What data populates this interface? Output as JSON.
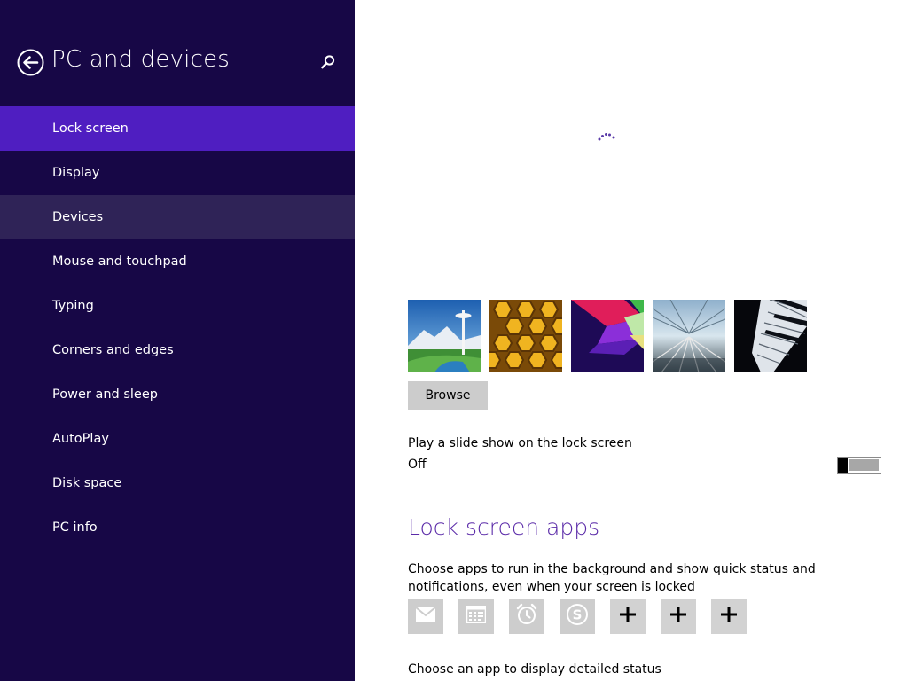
{
  "header": {
    "title": "PC and devices"
  },
  "nav": {
    "items": [
      {
        "label": "Lock screen"
      },
      {
        "label": "Display"
      },
      {
        "label": "Devices"
      },
      {
        "label": "Mouse and touchpad"
      },
      {
        "label": "Typing"
      },
      {
        "label": "Corners and edges"
      },
      {
        "label": "Power and sleep"
      },
      {
        "label": "AutoPlay"
      },
      {
        "label": "Disk space"
      },
      {
        "label": "PC info"
      }
    ],
    "selected": "Lock screen",
    "hovered": "Devices"
  },
  "lockscreen": {
    "browse_label": "Browse",
    "slideshow_label": "Play a slide show on the lock screen",
    "slideshow_state": "Off",
    "slideshow_on": false
  },
  "apps": {
    "heading": "Lock screen apps",
    "description": "Choose apps to run in the background and show quick status and notifications, even when your screen is locked",
    "slots": [
      "mail-icon",
      "calendar-icon",
      "alarm-icon",
      "skype-icon",
      "plus-icon",
      "plus-icon",
      "plus-icon"
    ],
    "detail_label": "Choose an app to display detailed status"
  },
  "colors": {
    "sidebar_bg": "#170746",
    "selected_bg": "#4f1ec1",
    "hover_bg": "#2f2357",
    "heading_accent": "#5a2aa8"
  }
}
